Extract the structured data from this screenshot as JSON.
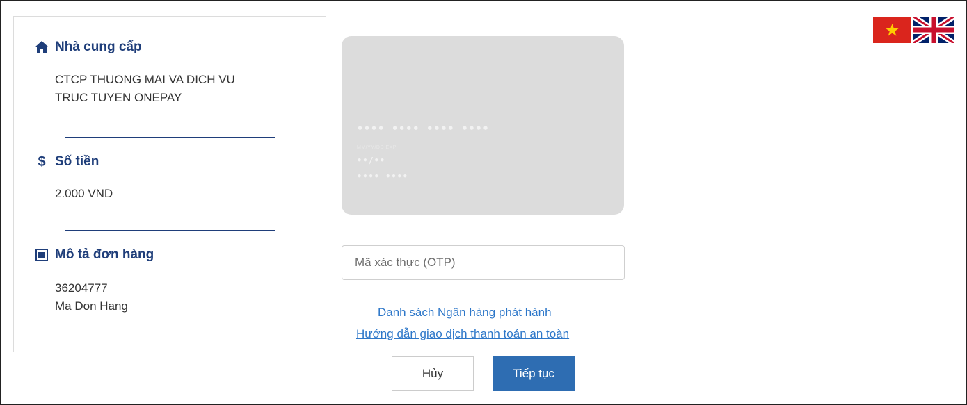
{
  "merchant": {
    "title": "Nhà cung cấp",
    "name_line1": "CTCP THUONG MAI VA DICH VU",
    "name_line2": "TRUC TUYEN ONEPAY"
  },
  "amount": {
    "title": "Số tiền",
    "currency_symbol": "$",
    "value": "2.000 VND"
  },
  "order": {
    "title": "Mô tả đơn hàng",
    "id": "36204777",
    "description": "Ma Don Hang"
  },
  "card_preview": {
    "number": "•••• •••• •••• ••••",
    "holder_label": "MM/YY/DD EXP",
    "expiry": "••/••",
    "name": "•••• ••••",
    "color": "#dcdcdc"
  },
  "otp_input": {
    "placeholder": "Mã xác thực (OTP)",
    "value": ""
  },
  "links": {
    "issuer_list": "Danh sách Ngân hàng phát hành",
    "safety_guide": "Hướng dẫn giao dịch thanh toán an toàn"
  },
  "buttons": {
    "cancel": "Hủy",
    "continue": "Tiếp tục"
  },
  "language": {
    "vietnamese_icon": "vietnam-flag",
    "english_icon": "uk-flag"
  },
  "colors": {
    "heading": "#1f3e7a",
    "primary_button": "#2e6db2",
    "link": "#2d77c9"
  }
}
